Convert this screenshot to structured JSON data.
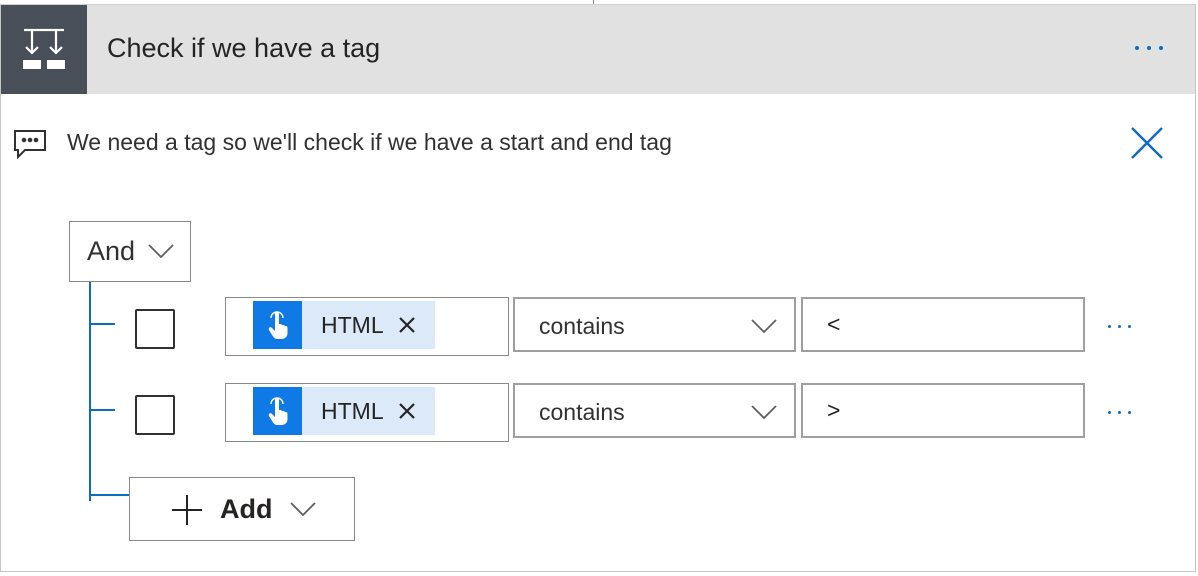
{
  "header": {
    "title": "Check if we have a tag",
    "icon": "condition-icon",
    "more_icon": "more-options-icon"
  },
  "comment": {
    "text": "We need a tag so we'll check if we have a start and end tag",
    "icon": "comment-icon",
    "close_icon": "close-icon"
  },
  "group": {
    "operator": "And"
  },
  "rows": [
    {
      "token": "HTML",
      "operator": "contains",
      "value": "<"
    },
    {
      "token": "HTML",
      "operator": "contains",
      "value": ">"
    }
  ],
  "add_button": {
    "label": "Add"
  },
  "colors": {
    "accent": "#0f6cbd",
    "token_bg": "#dbe9f8",
    "token_icon_bg": "#0f7ae5",
    "header_bg": "#e1e1e1",
    "header_icon_bg": "#484f58"
  }
}
